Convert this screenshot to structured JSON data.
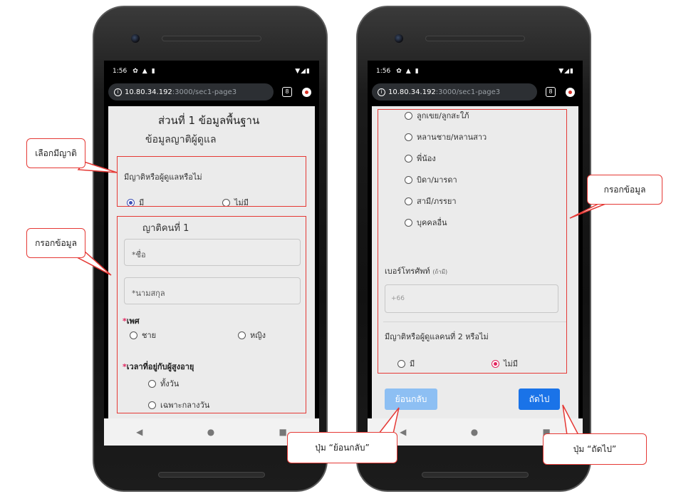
{
  "status_bar": {
    "time": "1:56",
    "icons": [
      "settings-icon",
      "alert-icon",
      "sim-icon"
    ],
    "signal": "signal-icon",
    "battery": "battery-icon"
  },
  "browser": {
    "url_host": "10.80.34.192",
    "url_path": ":3000/sec1-page3",
    "tab_count": "8"
  },
  "left_page": {
    "title": "ส่วนที่ 1 ข้อมูลพื้นฐาน",
    "subtitle": "ข้อมูลญาติผู้ดูแล",
    "has_relative_question": "มีญาติหรือผู้ดูแลหรือไม่",
    "has_relative_options": [
      {
        "label": "มี",
        "selected": true
      },
      {
        "label": "ไม่มี",
        "selected": false
      }
    ],
    "relative_heading": "ญาติคนที่ 1",
    "first_name_placeholder": "*ชื่อ",
    "last_name_placeholder": "*นามสกุล",
    "gender_star": "*",
    "gender_label": "เพศ",
    "gender_options": [
      "ชาย",
      "หญิง"
    ],
    "time_star": "*",
    "time_label": "เวลาที่อยู่กับผู้สูงอายุ",
    "time_options": [
      "ทั้งวัน",
      "เฉพาะกลางวัน"
    ]
  },
  "right_page": {
    "relationship_options": [
      "ลูกเขย/ลูกสะใภ้",
      "หลานชาย/หลานสาว",
      "พี่น้อง",
      "บิดา/มารดา",
      "สามี/ภรรยา",
      "บุคคลอื่น"
    ],
    "phone_label": "เบอร์โทรศัพท์",
    "phone_optional": "(ถ้ามี)",
    "phone_placeholder": "+66",
    "second_relative_question": "มีญาติหรือผู้ดูแลคนที่ 2 หรือไม่",
    "second_relative_options": [
      {
        "label": "มี",
        "selected": false
      },
      {
        "label": "ไม่มี",
        "selected": true
      }
    ],
    "back_button": "ย้อนกลับ",
    "next_button": "ถัดไป"
  },
  "nav_bar": {
    "back": "◀",
    "home": "●",
    "recents": "■"
  },
  "annotations": {
    "select_relative": "เลือกมีญาติ",
    "fill_info_left": "กรอกข้อมูล",
    "fill_info_right": "กรอกข้อมูล",
    "back_button_note": "ปุ่ม “ย้อนกลับ”",
    "next_button_note": "ปุ่ม “ถัดไป”"
  },
  "colors": {
    "highlight": "#e53935",
    "radio_selected_left": "#3f51b5",
    "radio_selected_right": "#e0245e",
    "primary_button": "#1a73e8",
    "disabled_button": "#8dbff3"
  }
}
